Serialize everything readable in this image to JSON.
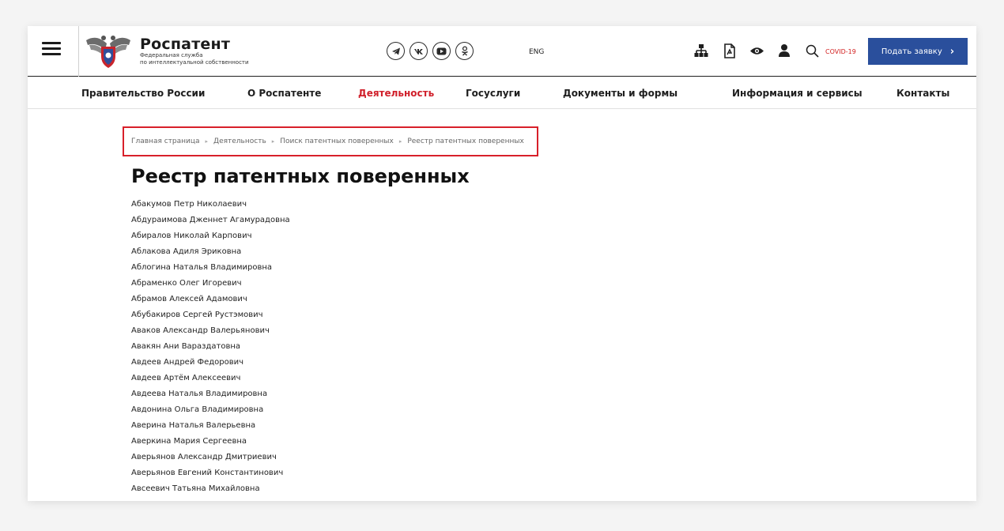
{
  "header": {
    "logo_title": "Роспатент",
    "logo_subtitle_1": "Федеральная служба",
    "logo_subtitle_2": "по интеллектуальной собственности",
    "lang": "ENG",
    "covid": "COVID-19",
    "apply_label": "Подать заявку",
    "apply_color": "#2a4f9c",
    "social_icons": [
      "telegram-icon",
      "vk-icon",
      "youtube-icon",
      "odnoklassniki-icon"
    ],
    "tool_icons": [
      "sitemap-icon",
      "document-icon",
      "eye-icon",
      "user-icon",
      "search-icon"
    ]
  },
  "nav": {
    "items": [
      {
        "label": "Правительство России"
      },
      {
        "label": "О Роспатенте"
      },
      {
        "label": "Деятельность",
        "active": true
      },
      {
        "label": "Госуслуги"
      },
      {
        "label": "Документы и формы"
      },
      {
        "label": "Информация и сервисы"
      },
      {
        "label": "Контакты"
      }
    ],
    "active_color": "#d01f2a"
  },
  "breadcrumb": {
    "items": [
      {
        "label": "Главная страница"
      },
      {
        "label": "Деятельность"
      },
      {
        "label": "Поиск патентных поверенных"
      },
      {
        "label": "Реестр патентных поверенных"
      }
    ],
    "highlight_color": "#d8202a"
  },
  "main": {
    "title": "Реестр патентных поверенных",
    "names": [
      "Абакумов Петр Николаевич",
      "Абдураимова Дженнет Агамурадовна",
      "Абиралов Николай Карпович",
      "Аблакова Адиля Эриковна",
      "Аблогина Наталья Владимировна",
      "Абраменко Олег Игоревич",
      "Абрамов Алексей Адамович",
      "Абубакиров Сергей Рустэмович",
      "Аваков Александр Валерьянович",
      "Авакян Ани Вараздатовна",
      "Авдеев Андрей Федорович",
      "Авдеев Артём Алексеевич",
      "Авдеева Наталья Владимировна",
      "Авдонина Ольга Владимировна",
      "Аверина Наталья Валерьевна",
      "Аверкина Мария Сергеевна",
      "Аверьянов Александр Дмитриевич",
      "Аверьянов Евгений Константинович",
      "Авсеевич Татьяна Михайловна"
    ]
  }
}
